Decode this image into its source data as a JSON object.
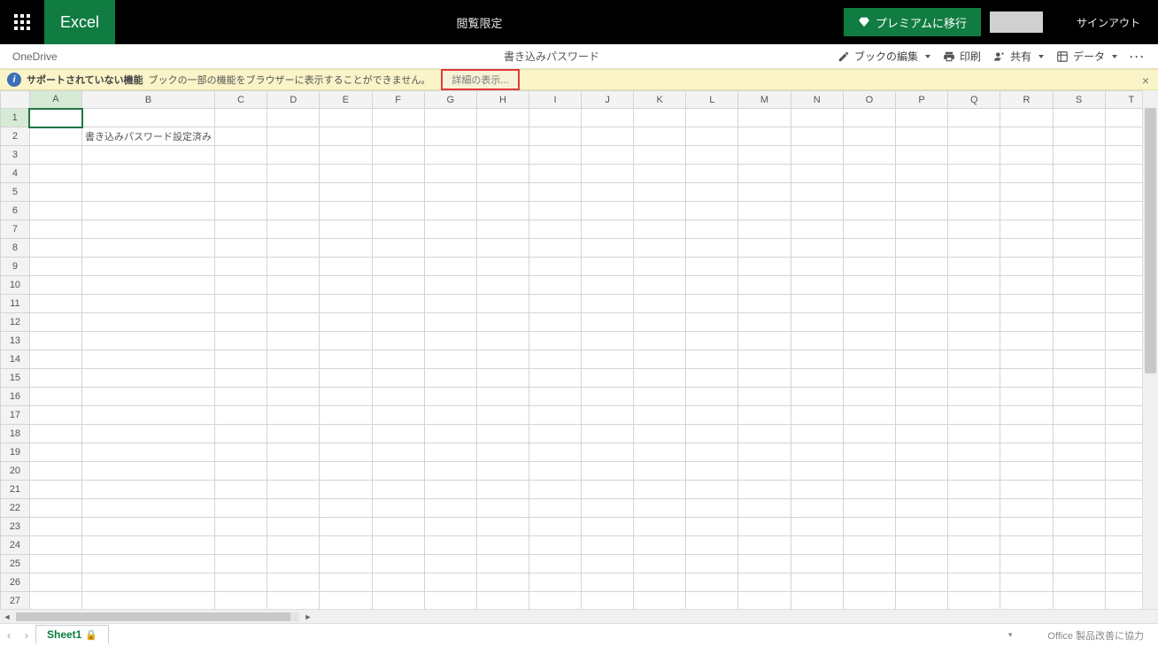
{
  "topbar": {
    "app_name": "Excel",
    "mode_label": "閲覧限定",
    "premium_label": "プレミアムに移行",
    "signout_label": "サインアウト"
  },
  "toolbar": {
    "location": "OneDrive",
    "doc_title": "書き込みパスワード",
    "edit_label": "ブックの編集",
    "print_label": "印刷",
    "share_label": "共有",
    "data_label": "データ"
  },
  "notification": {
    "title": "サポートされていない機能",
    "message": "ブックの一部の機能をブラウザーに表示することができません。",
    "details_button": "詳細の表示..."
  },
  "columns": [
    "A",
    "B",
    "C",
    "D",
    "E",
    "F",
    "G",
    "H",
    "I",
    "J",
    "K",
    "L",
    "M",
    "N",
    "O",
    "P",
    "Q",
    "R",
    "S",
    "T"
  ],
  "row_count": 27,
  "selected_cell": {
    "row": 1,
    "col": "A"
  },
  "cells": {
    "B2": "書き込みパスワード設定済み"
  },
  "sheet_tab": {
    "name": "Sheet1"
  },
  "statusbar": {
    "feedback": "Office 製品改善に協力"
  }
}
